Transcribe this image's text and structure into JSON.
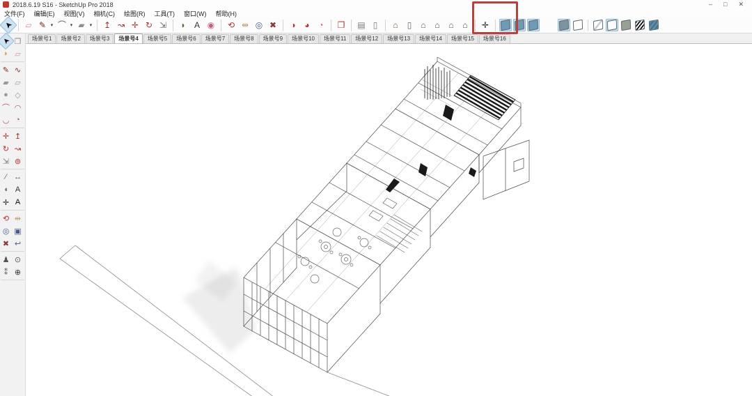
{
  "window": {
    "title": "2018.6.19 S16 - SketchUp Pro 2018",
    "controls": [
      {
        "name": "minimize-button",
        "glyph": "–"
      },
      {
        "name": "restore-button",
        "glyph": "□"
      },
      {
        "name": "close-button",
        "glyph": "✕"
      }
    ]
  },
  "menu_bar": {
    "items": [
      {
        "name": "file",
        "label": "文件(F)"
      },
      {
        "name": "edit",
        "label": "编辑(E)"
      },
      {
        "name": "view",
        "label": "视图(V)"
      },
      {
        "name": "camera",
        "label": "相机(C)"
      },
      {
        "name": "draw",
        "label": "绘图(R)"
      },
      {
        "name": "tools",
        "label": "工具(T)"
      },
      {
        "name": "window",
        "label": "窗口(W)"
      },
      {
        "name": "help",
        "label": "帮助(H)"
      }
    ]
  },
  "theme": {
    "annotation_red": "#b5433c",
    "active_tool_bg": "#cde3f2",
    "toolbar_red": "#b03434",
    "cube_blue": "#6f9ab4",
    "shaded_gray": "#98a096",
    "textured_teal": "#5b8ca8"
  },
  "top_toolbar": {
    "items": [
      {
        "name": "select-tool",
        "glyph": "➤",
        "color": "#111111",
        "rot": -135,
        "active": true
      },
      {
        "name": "eraser-tool",
        "sep": true,
        "glyph": "▱",
        "color": "#d98ca2"
      },
      {
        "name": "line-tool",
        "glyph": "✎",
        "color": "#7a2020",
        "caret": true
      },
      {
        "name": "arc-tool",
        "glyph": "⌒",
        "color": "#555555",
        "caret": true
      },
      {
        "name": "rectangle-tool",
        "glyph": "▰",
        "color": "#8f8f89",
        "caret": true
      },
      {
        "name": "push-pull-tool",
        "sep": true,
        "glyph": "↥",
        "color": "#a03232"
      },
      {
        "name": "follow-me-tool",
        "glyph": "↝",
        "color": "#a03232"
      },
      {
        "name": "move-tool",
        "glyph": "✛",
        "color": "#b03434"
      },
      {
        "name": "rotate-tool",
        "glyph": "↻",
        "color": "#b03434"
      },
      {
        "name": "scale-tool",
        "glyph": "⇲",
        "color": "#6b6b6b"
      },
      {
        "name": "paint-bucket-tool",
        "sep": true,
        "glyph": "◗",
        "color": "#4a6b3a"
      },
      {
        "name": "text-tool",
        "glyph": "A",
        "color": "#333333"
      },
      {
        "name": "materials-tool",
        "glyph": "◉",
        "color": "#c06080"
      },
      {
        "name": "orbit-tool",
        "sep": true,
        "glyph": "⟲",
        "color": "#b03434"
      },
      {
        "name": "pan-tool",
        "glyph": "⇹",
        "color": "#c09a6a"
      },
      {
        "name": "zoom-tool",
        "glyph": "◎",
        "color": "#4a5a88"
      },
      {
        "name": "zoom-extents-tool",
        "glyph": "✖",
        "color": "#8a3a3a"
      },
      {
        "name": "section-plane-tool",
        "sep": true,
        "glyph": "◑",
        "color": "#b03434"
      },
      {
        "name": "section-display-toggle",
        "glyph": "◕",
        "color": "#b03434"
      },
      {
        "name": "section-fill-toggle",
        "glyph": "◔",
        "color": "#d06868"
      },
      {
        "name": "make-component-tool",
        "sep": true,
        "glyph": "❐",
        "color": "#b03434"
      },
      {
        "name": "print-button",
        "sep": true,
        "glyph": "▤",
        "color": "#777777"
      },
      {
        "name": "model-info-button",
        "glyph": "▯",
        "color": "#777777"
      },
      {
        "name": "view-iso-button",
        "sep": true,
        "glyph": "⌂",
        "color": "#7a5a3a"
      },
      {
        "name": "view-top-button",
        "glyph": "▯",
        "color": "#666666"
      },
      {
        "name": "view-front-button",
        "glyph": "⌂",
        "color": "#555555"
      },
      {
        "name": "view-right-button",
        "glyph": "⌂",
        "color": "#555555"
      },
      {
        "name": "view-left-button",
        "glyph": "⌂",
        "color": "#555555"
      },
      {
        "name": "view-back-button",
        "glyph": "⌂",
        "color": "#555555"
      },
      {
        "name": "axes-tool",
        "sep": true,
        "glyph": "✛",
        "color": "#222222"
      },
      {
        "name": "view-cube-toggle-1",
        "sep": true,
        "swatch": "solid",
        "color": "#6f9ab4",
        "lit": true
      },
      {
        "name": "view-cube-toggle-2",
        "swatch": "solid",
        "color": "#6f9ab4",
        "lit": true
      },
      {
        "name": "view-cube-toggle-3",
        "swatch": "solid",
        "color": "#6f9ab4",
        "lit": true
      },
      {
        "name": "toolbar-empty-slot",
        "spacer": 24
      },
      {
        "name": "style-monochrome-button",
        "swatch": "solid",
        "color": "#7e93a0",
        "lit": true
      },
      {
        "name": "style-back-edges-button",
        "swatch": "outline"
      },
      {
        "name": "style-xray-button",
        "sep": true,
        "swatch": "fold"
      },
      {
        "name": "style-wireframe-button",
        "swatch": "outline",
        "lit": true
      },
      {
        "name": "style-shaded-button",
        "swatch": "solid",
        "color": "#98a096"
      },
      {
        "name": "style-hidden-line-button",
        "swatch": "striped"
      },
      {
        "name": "style-textured-button",
        "swatch": "textured"
      }
    ]
  },
  "scene_tabs": {
    "tabs": [
      {
        "label": "场景号1"
      },
      {
        "label": "场景号2"
      },
      {
        "label": "场景号3"
      },
      {
        "label": "场景号4",
        "active": true
      },
      {
        "label": "场景号5"
      },
      {
        "label": "场景号6"
      },
      {
        "label": "场景号7"
      },
      {
        "label": "场景号8"
      },
      {
        "label": "场景号9"
      },
      {
        "label": "场景号10"
      },
      {
        "label": "场景号11"
      },
      {
        "label": "场景号12"
      },
      {
        "label": "场景号13"
      },
      {
        "label": "场景号14"
      },
      {
        "label": "场景号15"
      },
      {
        "label": "场景号16"
      }
    ]
  },
  "tool_palette": {
    "rows": [
      {
        "a": {
          "name": "select-tool",
          "glyph": "➤",
          "color": "#111111",
          "rot": -135,
          "active": true
        },
        "b": {
          "name": "make-component-tool",
          "glyph": "❐",
          "color": "#8a8a8a"
        }
      },
      {
        "a": {
          "name": "paint-bucket-tool",
          "glyph": "◗",
          "color": "#c8a23a"
        },
        "b": {
          "name": "eraser-tool",
          "glyph": "▱",
          "color": "#d98ca2"
        },
        "sepAfter": true
      },
      {
        "a": {
          "name": "line-tool",
          "glyph": "✎",
          "color": "#8a2525"
        },
        "b": {
          "name": "freehand-tool",
          "glyph": "∿",
          "color": "#8a2525"
        }
      },
      {
        "a": {
          "name": "rectangle-tool",
          "glyph": "▰",
          "color": "#9a9a94"
        },
        "b": {
          "name": "rotated-rectangle-tool",
          "glyph": "▱",
          "color": "#9a9a94"
        }
      },
      {
        "a": {
          "name": "circle-tool",
          "glyph": "●",
          "color": "#9a9a94"
        },
        "b": {
          "name": "polygon-tool",
          "glyph": "◇",
          "color": "#9a9a94"
        }
      },
      {
        "a": {
          "name": "arc-tool",
          "glyph": "⌒",
          "color": "#b05060"
        },
        "b": {
          "name": "two-point-arc-tool",
          "glyph": "◠",
          "color": "#b05060"
        }
      },
      {
        "a": {
          "name": "three-point-arc-tool",
          "glyph": "◡",
          "color": "#b05060"
        },
        "b": {
          "name": "pie-tool",
          "glyph": "◔",
          "color": "#b05060"
        },
        "sepAfter": true
      },
      {
        "a": {
          "name": "move-tool",
          "glyph": "✛",
          "color": "#b03030"
        },
        "b": {
          "name": "push-pull-tool",
          "glyph": "↥",
          "color": "#b03030"
        }
      },
      {
        "a": {
          "name": "rotate-tool",
          "glyph": "↻",
          "color": "#b03030"
        },
        "b": {
          "name": "follow-me-tool",
          "glyph": "↝",
          "color": "#b03030"
        }
      },
      {
        "a": {
          "name": "scale-tool",
          "glyph": "⇲",
          "color": "#777777"
        },
        "b": {
          "name": "offset-tool",
          "glyph": "⊚",
          "color": "#b03030"
        },
        "sepAfter": true
      },
      {
        "a": {
          "name": "tape-measure-tool",
          "glyph": "∕",
          "color": "#3a7a3a"
        },
        "b": {
          "name": "dimension-tool",
          "glyph": "↔",
          "color": "#555555"
        }
      },
      {
        "a": {
          "name": "protractor-tool",
          "glyph": "◖",
          "color": "#3a7a3a"
        },
        "b": {
          "name": "text-tool",
          "glyph": "A",
          "color": "#333333"
        }
      },
      {
        "a": {
          "name": "axes-tool",
          "glyph": "✛",
          "color": "#222222"
        },
        "b": {
          "name": "threed-text-tool",
          "glyph": "A",
          "color": "#0a0a0a"
        },
        "sepAfter": true
      },
      {
        "a": {
          "name": "orbit-tool",
          "glyph": "⟲",
          "color": "#b03030"
        },
        "b": {
          "name": "pan-tool",
          "glyph": "⇹",
          "color": "#c09a6a"
        }
      },
      {
        "a": {
          "name": "zoom-tool",
          "glyph": "◎",
          "color": "#4a5a88"
        },
        "b": {
          "name": "zoom-window-tool",
          "glyph": "▣",
          "color": "#4a5a88"
        }
      },
      {
        "a": {
          "name": "zoom-extents-tool",
          "glyph": "✖",
          "color": "#8a3a3a"
        },
        "b": {
          "name": "zoom-previous-tool",
          "glyph": "↩",
          "color": "#4a5a88"
        },
        "sepAfter": true
      },
      {
        "a": {
          "name": "position-camera-tool",
          "glyph": "♟",
          "color": "#555555"
        },
        "b": {
          "name": "look-around-tool",
          "glyph": "⊙",
          "color": "#555555"
        }
      },
      {
        "a": {
          "name": "walk-tool",
          "glyph": "⁑",
          "color": "#555555"
        },
        "b": {
          "name": "section-plane-tool",
          "glyph": "⊕",
          "color": "#333333"
        },
        "sepAfter": true
      }
    ]
  },
  "annotation": {
    "name": "highlight-rectangle",
    "color": "#b5433c"
  }
}
